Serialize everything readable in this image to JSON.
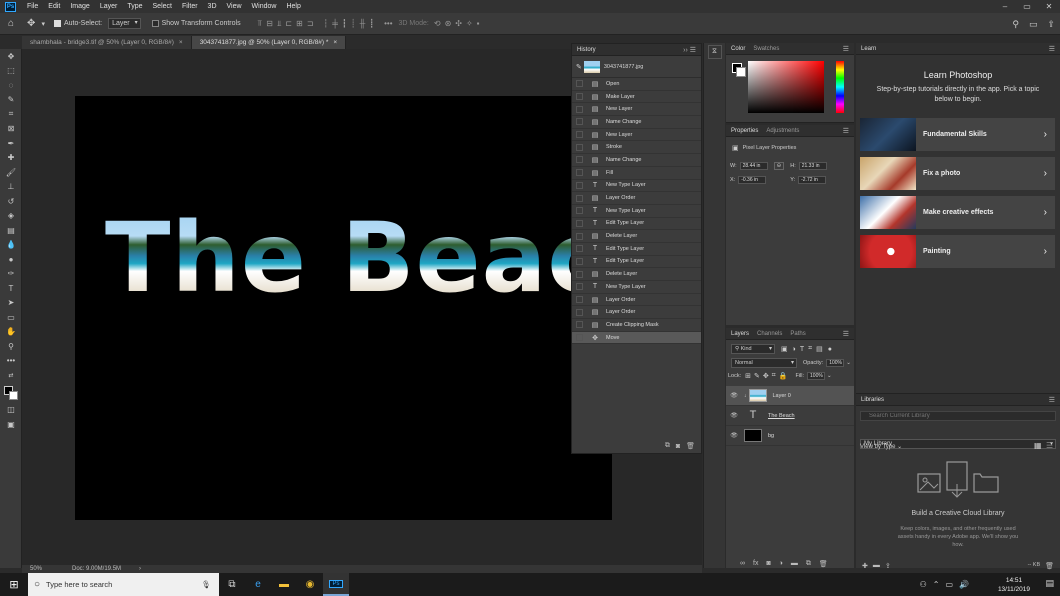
{
  "menu": {
    "items": [
      "File",
      "Edit",
      "Image",
      "Layer",
      "Type",
      "Select",
      "Filter",
      "3D",
      "View",
      "Window",
      "Help"
    ]
  },
  "options_bar": {
    "auto_select_label": "Auto-Select:",
    "auto_select_value": "Layer",
    "transform_controls_label": "Show Transform Controls",
    "mode_3d_label": "3D Mode:"
  },
  "tabs": [
    {
      "label": "shambhala - bridge3.tif @ 50% (Layer 0, RGB/8#)",
      "close": "×"
    },
    {
      "label": "3043741877.jpg @ 50% (Layer 0, RGB/8#) *",
      "close": "×"
    }
  ],
  "canvas": {
    "text": "The Beach"
  },
  "status": {
    "zoom": "50%",
    "doc": "Doc: 9.00M/19.5M"
  },
  "history": {
    "title": "History",
    "snapshot": "3043741877.jpg",
    "items": [
      {
        "label": "Open",
        "icon": "doc"
      },
      {
        "label": "Make Layer",
        "icon": "doc"
      },
      {
        "label": "New Layer",
        "icon": "doc"
      },
      {
        "label": "Name Change",
        "icon": "doc"
      },
      {
        "label": "New Layer",
        "icon": "doc"
      },
      {
        "label": "Stroke",
        "icon": "doc"
      },
      {
        "label": "Name Change",
        "icon": "doc"
      },
      {
        "label": "Fill",
        "icon": "doc"
      },
      {
        "label": "New Type Layer",
        "icon": "T"
      },
      {
        "label": "Layer Order",
        "icon": "doc"
      },
      {
        "label": "New Type Layer",
        "icon": "T"
      },
      {
        "label": "Edit Type Layer",
        "icon": "T"
      },
      {
        "label": "Delete Layer",
        "icon": "doc"
      },
      {
        "label": "Edit Type Layer",
        "icon": "T"
      },
      {
        "label": "Edit Type Layer",
        "icon": "T"
      },
      {
        "label": "Delete Layer",
        "icon": "doc"
      },
      {
        "label": "New Type Layer",
        "icon": "T"
      },
      {
        "label": "Layer Order",
        "icon": "doc"
      },
      {
        "label": "Layer Order",
        "icon": "doc"
      },
      {
        "label": "Create Clipping Mask",
        "icon": "doc"
      },
      {
        "label": "Move",
        "icon": "move"
      }
    ]
  },
  "color_panel": {
    "tabs": [
      "Color",
      "Swatches"
    ]
  },
  "properties": {
    "tabs": [
      "Properties",
      "Adjustments"
    ],
    "subtitle": "Pixel Layer Properties",
    "w_label": "W:",
    "w_value": "28.44 in",
    "h_label": "H:",
    "h_value": "21.33 in",
    "x_label": "X:",
    "x_value": "-0.36 in",
    "y_label": "Y:",
    "y_value": "-2.72 in"
  },
  "layers": {
    "tabs": [
      "Layers",
      "Channels",
      "Paths"
    ],
    "filter": "Kind",
    "blend_mode": "Normal",
    "opacity_label": "Opacity:",
    "opacity_value": "100%",
    "lock_label": "Lock:",
    "fill_label": "Fill:",
    "fill_value": "100%",
    "items": [
      {
        "name": "Layer 0",
        "kind": "image"
      },
      {
        "name": "The Beach",
        "kind": "text"
      },
      {
        "name": "bg",
        "kind": "fill"
      }
    ]
  },
  "learn": {
    "tab": "Learn",
    "heading": "Learn Photoshop",
    "body": "Step-by-step tutorials directly in the app. Pick a topic below to begin.",
    "cards": [
      "Fundamental Skills",
      "Fix a photo",
      "Make creative effects",
      "Painting"
    ]
  },
  "libraries": {
    "tab": "Libraries",
    "search_placeholder": "Search Current Library",
    "library": "My Library",
    "view_by": "View by Type",
    "empty_title": "Build a Creative Cloud Library",
    "empty_body": "Keep colors, images, and other frequently used assets handy in every Adobe app. We'll show you how.",
    "size": "-- KB"
  },
  "taskbar": {
    "search_placeholder": "Type here to search",
    "time": "14:51",
    "date": "13/11/2019"
  }
}
